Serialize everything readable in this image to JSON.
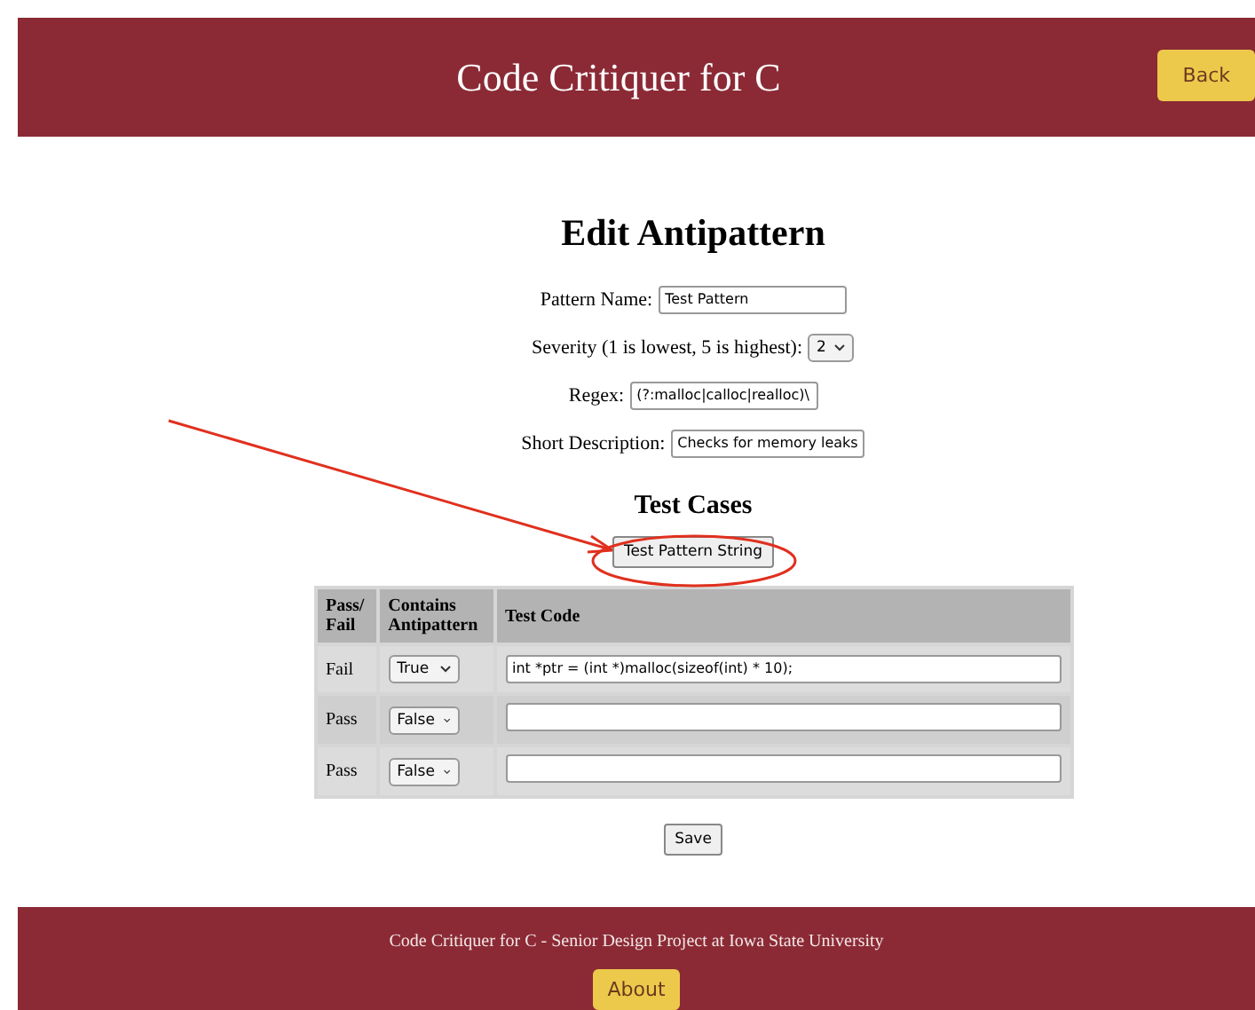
{
  "header": {
    "title": "Code Critiquer for C",
    "back_button": "Back"
  },
  "heading": "Edit Antipattern",
  "form": [
    {
      "kind": "text",
      "label": "Pattern Name:",
      "value": "Test Pattern"
    },
    {
      "kind": "select",
      "label": "Severity (1 is lowest, 5 is highest):",
      "value": "2"
    },
    {
      "kind": "text",
      "label": "Regex:",
      "value": "(?:malloc|calloc|realloc)\\"
    },
    {
      "kind": "text",
      "label": "Short Description:",
      "value": "Checks for memory leaks"
    }
  ],
  "test_cases": {
    "title": "Test Cases",
    "test_button": "Test Pattern String",
    "columns": [
      "Pass/ Fail",
      "Contains Antipattern",
      "Test Code"
    ],
    "rows": [
      {
        "result": "Fail",
        "contains": "True",
        "code": "int *ptr = (int *)malloc(sizeof(int) * 10);"
      },
      {
        "result": "Pass",
        "contains": "False",
        "code": ""
      },
      {
        "result": "Pass",
        "contains": "False",
        "code": ""
      }
    ],
    "save_button": "Save"
  },
  "footer": {
    "text": "Code Critiquer for C - Senior Design Project at Iowa State University",
    "about_button": "About"
  }
}
